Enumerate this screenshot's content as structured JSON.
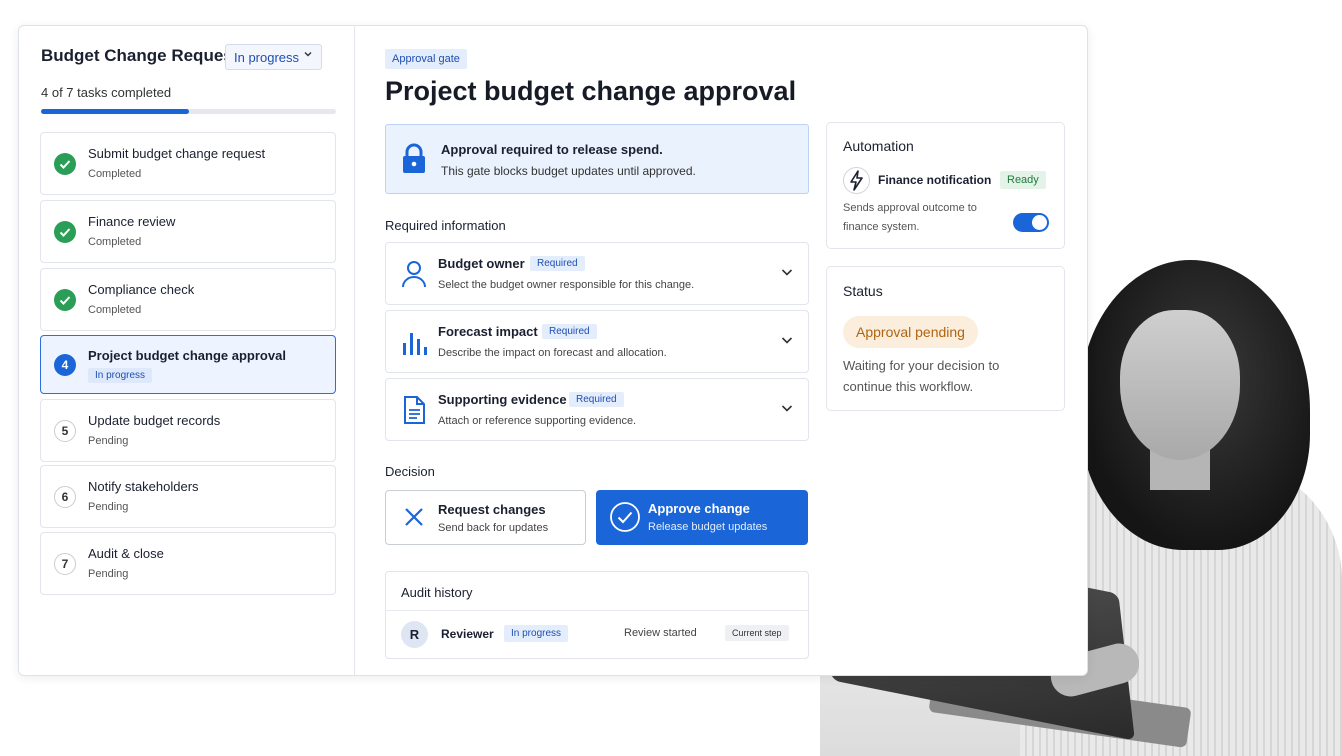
{
  "sidebar": {
    "title": "Budget Change Request",
    "status_dropdown": "In progress",
    "progress_text": "4 of 7 tasks completed",
    "progress_fraction": 0.5,
    "tasks": [
      {
        "label": "Submit budget change request",
        "status": "Completed",
        "marker": "check"
      },
      {
        "label": "Finance review",
        "status": "Completed",
        "marker": "check"
      },
      {
        "label": "Compliance check",
        "status": "Completed",
        "marker": "check"
      },
      {
        "label": "Project budget change approval",
        "status": "In progress",
        "marker": "4"
      },
      {
        "label": "Update budget records",
        "status": "Pending",
        "marker": "5"
      },
      {
        "label": "Notify stakeholders",
        "status": "Pending",
        "marker": "6"
      },
      {
        "label": "Audit & close",
        "status": "Pending",
        "marker": "7"
      }
    ]
  },
  "main": {
    "chip": "Approval gate",
    "title": "Project budget change approval",
    "alert": {
      "title": "Approval required to release spend.",
      "subtitle": "This gate blocks budget updates until approved.",
      "icon": "lock-icon"
    },
    "required_label": "Required information",
    "required_items": [
      {
        "title": "Budget owner",
        "badge": "Required",
        "description": "Select the budget owner responsible for this change.",
        "icon": "person-icon"
      },
      {
        "title": "Forecast impact",
        "badge": "Required",
        "description": "Describe the impact on forecast and allocation.",
        "icon": "bar-chart-icon"
      },
      {
        "title": "Supporting evidence",
        "badge": "Required",
        "description": "Attach or reference supporting evidence.",
        "icon": "document-icon"
      }
    ],
    "decision_label": "Decision",
    "decision": {
      "request": {
        "title": "Request changes",
        "subtitle": "Send back for updates"
      },
      "approve": {
        "title": "Approve change",
        "subtitle": "Release budget updates"
      }
    },
    "audit": {
      "title": "Audit history",
      "avatar": "R",
      "name": "Reviewer",
      "badge": "In progress",
      "event": "Review started",
      "step": "Current step"
    }
  },
  "automation": {
    "title": "Automation",
    "name": "Finance notification",
    "state": "Ready",
    "description": "Sends approval outcome to finance system.",
    "enabled": true
  },
  "status": {
    "title": "Status",
    "badge": "Approval pending",
    "description": "Waiting for your decision to continue this workflow."
  },
  "colors": {
    "accent": "#1a66d9",
    "success": "#2a9d57",
    "pending_bg": "#fbeedd",
    "pending_text": "#b06412"
  }
}
